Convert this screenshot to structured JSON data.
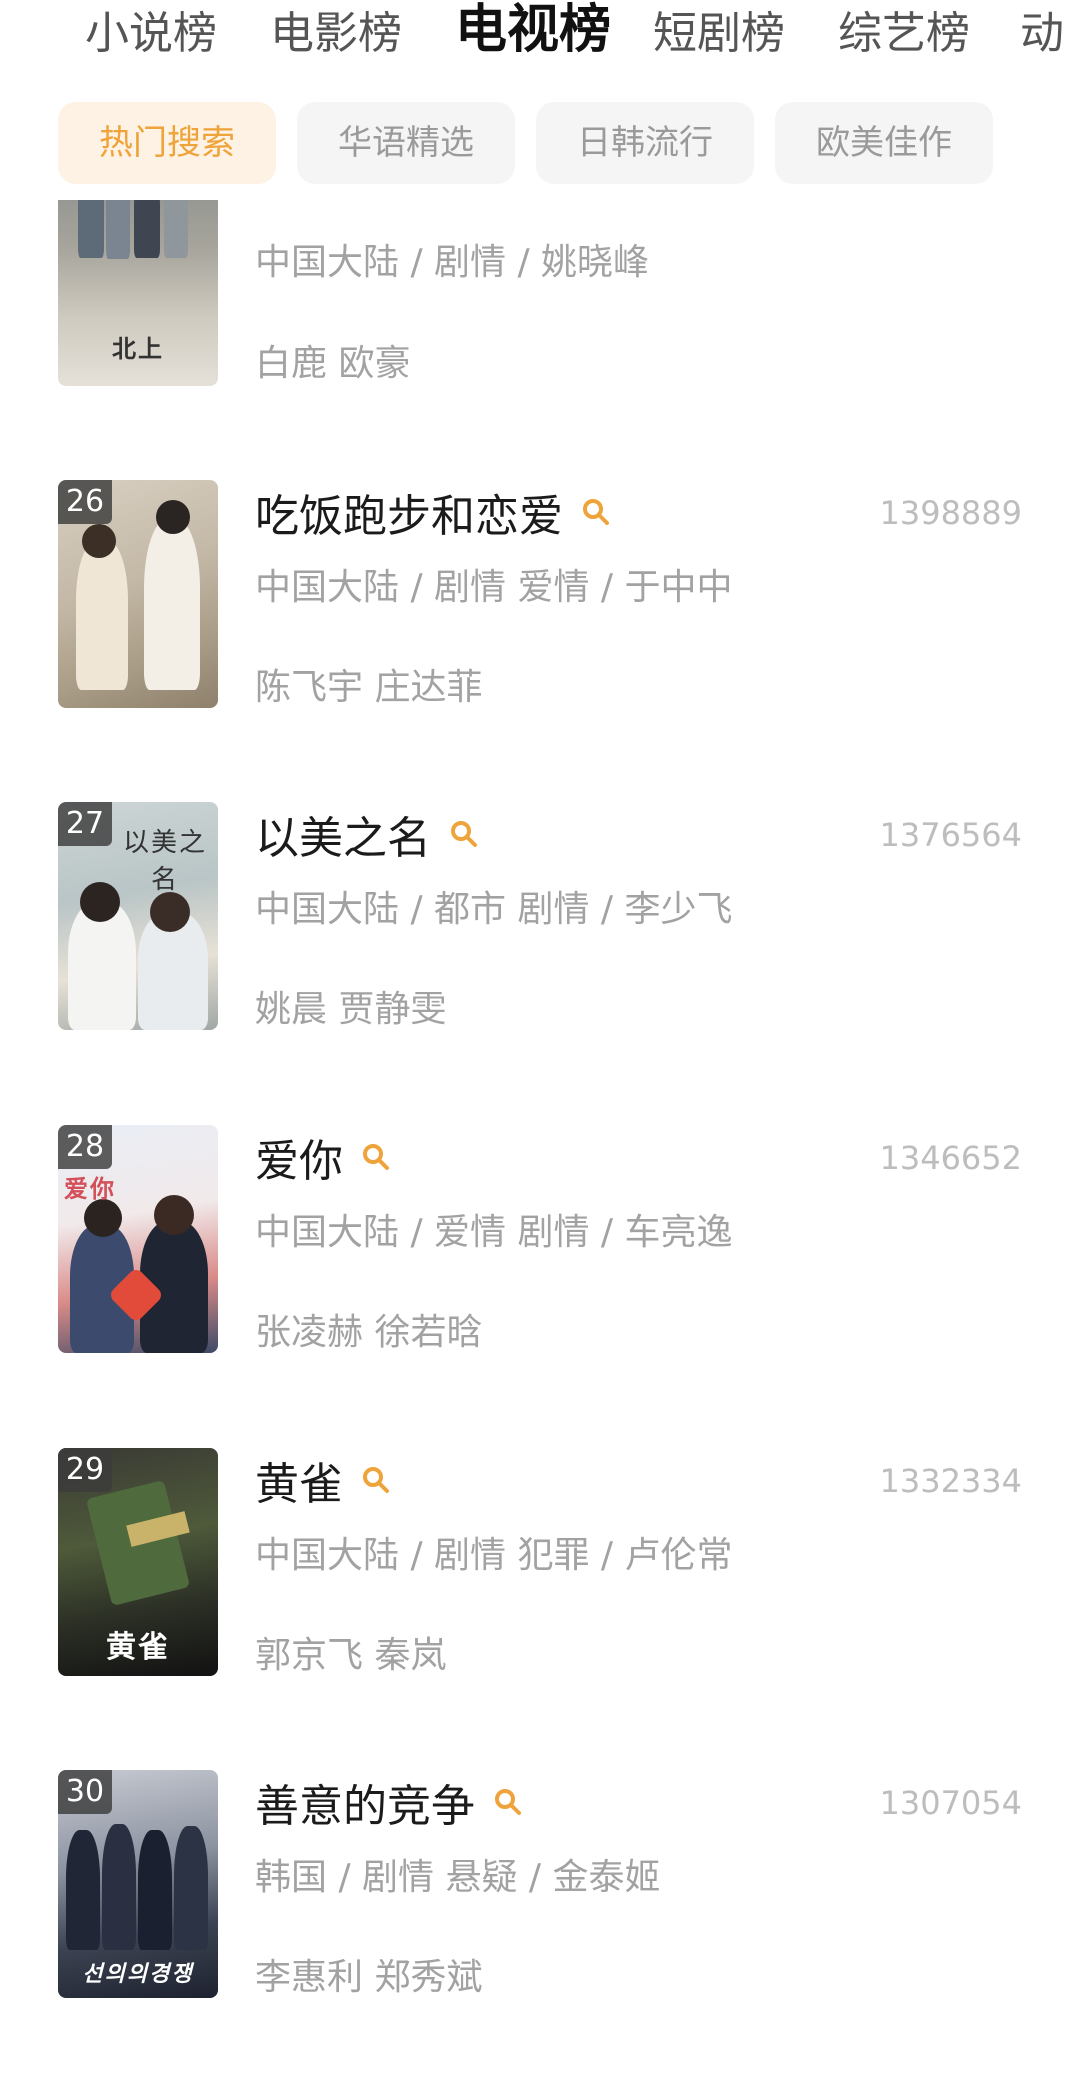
{
  "top_tabs": [
    {
      "label": "小说榜",
      "active": false
    },
    {
      "label": "电影榜",
      "active": false
    },
    {
      "label": "电视榜",
      "active": true
    },
    {
      "label": "短剧榜",
      "active": false
    },
    {
      "label": "综艺榜",
      "active": false
    },
    {
      "label": "动",
      "active": false
    }
  ],
  "filters": [
    {
      "label": "热门搜索",
      "active": true
    },
    {
      "label": "华语精选",
      "active": false
    },
    {
      "label": "日韩流行",
      "active": false
    },
    {
      "label": "欧美佳作",
      "active": false
    }
  ],
  "items": [
    {
      "rank": "",
      "title": "",
      "meta": "中国大陆 / 剧情 / 姚晓峰",
      "cast": "白鹿 欧豪",
      "score": "",
      "poster_caption": "北上"
    },
    {
      "rank": "26",
      "title": "吃饭跑步和恋爱",
      "meta": "中国大陆 / 剧情 爱情 / 于中中",
      "cast": "陈飞宇 庄达菲",
      "score": "1398889",
      "poster_caption": ""
    },
    {
      "rank": "27",
      "title": "以美之名",
      "meta": "中国大陆 / 都市 剧情 / 李少飞",
      "cast": "姚晨 贾静雯",
      "score": "1376564",
      "poster_caption": "以美之名"
    },
    {
      "rank": "28",
      "title": "爱你",
      "meta": "中国大陆 / 爱情 剧情 / 车亮逸",
      "cast": "张凌赫 徐若晗",
      "score": "1346652",
      "poster_caption": "爱你"
    },
    {
      "rank": "29",
      "title": "黄雀",
      "meta": "中国大陆 / 剧情 犯罪 / 卢伦常",
      "cast": "郭京飞 秦岚",
      "score": "1332334",
      "poster_caption": "黄雀"
    },
    {
      "rank": "30",
      "title": "善意的竞争",
      "meta": "韩国 / 剧情 悬疑 / 金泰姬",
      "cast": "李惠利 郑秀斌",
      "score": "1307054",
      "poster_caption": "선의의경쟁"
    }
  ],
  "colors": {
    "accent": "#eea33b",
    "pill_active_bg": "#fdf2e3",
    "pill_bg": "#f5f5f5",
    "muted_text": "#a2a2a2"
  },
  "icons": {
    "title_search": "search-icon"
  }
}
